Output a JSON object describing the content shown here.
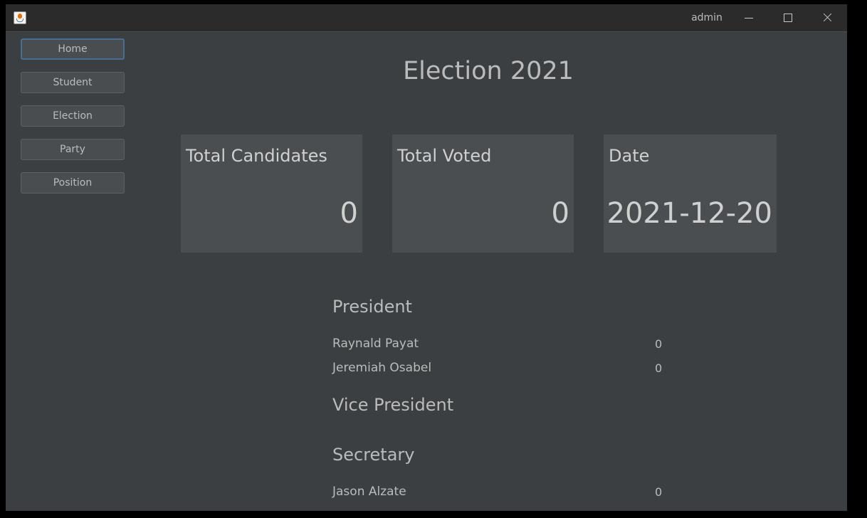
{
  "titlebar": {
    "user": "admin",
    "icon": "java-cup-icon"
  },
  "nav": {
    "items": [
      {
        "label": "Home",
        "active": true
      },
      {
        "label": "Student",
        "active": false
      },
      {
        "label": "Election",
        "active": false
      },
      {
        "label": "Party",
        "active": false
      },
      {
        "label": "Position",
        "active": false
      }
    ]
  },
  "main": {
    "title": "Election 2021",
    "cards": [
      {
        "label": "Total Candidates",
        "value": "0"
      },
      {
        "label": "Total Voted",
        "value": "0"
      },
      {
        "label": "Date",
        "value": "2021-12-20"
      }
    ],
    "positions": [
      {
        "title": "President",
        "candidates": [
          {
            "name": "Raynald Payat",
            "votes": "0"
          },
          {
            "name": "Jeremiah Osabel",
            "votes": "0"
          }
        ]
      },
      {
        "title": "Vice President",
        "candidates": []
      },
      {
        "title": "Secretary",
        "candidates": [
          {
            "name": "Jason Alzate",
            "votes": "0"
          }
        ]
      }
    ]
  },
  "colors": {
    "background": "#3c3f41",
    "titlebar": "#2b2b2b",
    "card": "#4b4e50",
    "text": "#bbbbbb",
    "focus_border": "#466d94"
  }
}
